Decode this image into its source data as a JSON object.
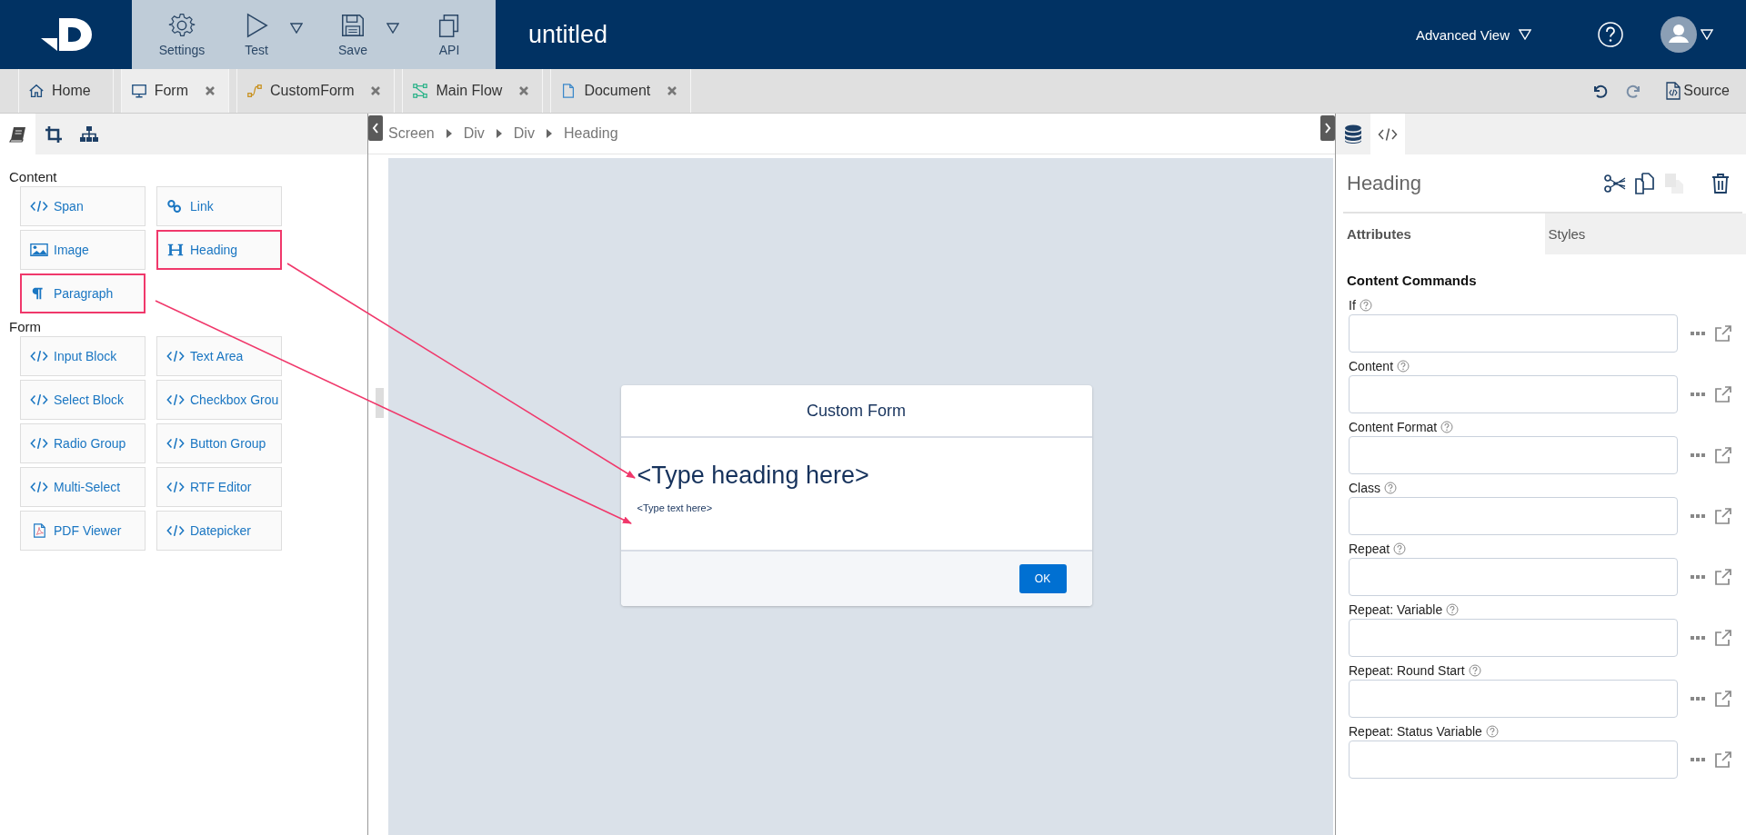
{
  "app_bar": {
    "toolbar": [
      {
        "label": "Settings",
        "kind": "settings",
        "has_menu": false
      },
      {
        "label": "Test",
        "kind": "test",
        "has_menu": true
      },
      {
        "label": "Save",
        "kind": "save",
        "has_menu": true
      },
      {
        "label": "API",
        "kind": "api",
        "has_menu": false
      }
    ],
    "title": "untitled",
    "view_menu": "Advanced View"
  },
  "tabs": [
    {
      "label": "Home",
      "kind": "home",
      "selected": false,
      "closable": false
    },
    {
      "label": "Form",
      "kind": "form",
      "selected": true,
      "closable": true
    },
    {
      "label": "CustomForm",
      "kind": "custom",
      "selected": false,
      "closable": true
    },
    {
      "label": "Main Flow",
      "kind": "flow",
      "selected": false,
      "closable": true
    },
    {
      "label": "Document",
      "kind": "document",
      "selected": false,
      "closable": true
    }
  ],
  "source_button": "Source",
  "left_panel": {
    "icon_tabs": [
      {
        "kind": "book",
        "selected": true
      },
      {
        "kind": "crop",
        "selected": false
      },
      {
        "kind": "tree",
        "selected": false
      }
    ],
    "sections": [
      {
        "title": "Content",
        "items": [
          {
            "label": "Span",
            "kind": "code",
            "highlighted": false
          },
          {
            "label": "Link",
            "kind": "link",
            "highlighted": false
          },
          {
            "label": "Image",
            "kind": "image",
            "highlighted": false
          },
          {
            "label": "Heading",
            "kind": "heading",
            "highlighted": true
          },
          {
            "label": "Paragraph",
            "kind": "paragraph",
            "highlighted": true
          }
        ]
      },
      {
        "title": "Form",
        "items": [
          {
            "label": "Input Block",
            "kind": "code",
            "highlighted": false
          },
          {
            "label": "Text Area",
            "kind": "code",
            "highlighted": false
          },
          {
            "label": "Select Block",
            "kind": "code",
            "highlighted": false
          },
          {
            "label": "Checkbox Grou",
            "kind": "code",
            "highlighted": false
          },
          {
            "label": "Radio Group",
            "kind": "code",
            "highlighted": false
          },
          {
            "label": "Button Group",
            "kind": "code",
            "highlighted": false
          },
          {
            "label": "Multi-Select",
            "kind": "code",
            "highlighted": false
          },
          {
            "label": "RTF Editor",
            "kind": "code",
            "highlighted": false
          },
          {
            "label": "PDF Viewer",
            "kind": "pdf",
            "highlighted": false
          },
          {
            "label": "Datepicker",
            "kind": "code",
            "highlighted": false
          }
        ]
      }
    ]
  },
  "breadcrumb": [
    "Screen",
    "Div",
    "Div",
    "Heading"
  ],
  "form": {
    "title": "Custom Form",
    "heading": "<Type heading here>",
    "paragraph": "<Type text here>",
    "button": "OK"
  },
  "right_panel": {
    "icon_tabs": [
      {
        "kind": "database",
        "selected": false
      },
      {
        "kind": "code",
        "selected": true
      }
    ],
    "title": "Heading",
    "actions": [
      {
        "kind": "cut",
        "disabled": false
      },
      {
        "kind": "copy",
        "disabled": false
      },
      {
        "kind": "paste",
        "disabled": true
      },
      {
        "kind": "delete",
        "disabled": false
      }
    ],
    "tabs": [
      {
        "label": "Attributes",
        "selected": true
      },
      {
        "label": "Styles",
        "selected": false
      }
    ],
    "section": "Content Commands",
    "fields": [
      {
        "label": "If"
      },
      {
        "label": "Content"
      },
      {
        "label": "Content Format"
      },
      {
        "label": "Class"
      },
      {
        "label": "Repeat"
      },
      {
        "label": "Repeat: Variable"
      },
      {
        "label": "Repeat: Round Start"
      },
      {
        "label": "Repeat: Status Variable"
      }
    ]
  }
}
